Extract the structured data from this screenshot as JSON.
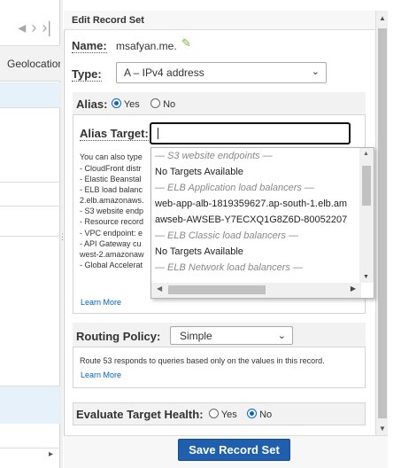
{
  "left_pane": {
    "column_header": "Geolocation"
  },
  "panel": {
    "title": "Edit Record Set",
    "name_label": "Name:",
    "name_value": "msafyan.me.",
    "type_label": "Type:",
    "type_value": "A – IPv4 address",
    "alias": {
      "label": "Alias:",
      "yes": "Yes",
      "no": "No",
      "selected": "Yes",
      "target_label": "Alias Target:",
      "target_value": "",
      "help_intro": "You can also type",
      "help_items": [
        "- CloudFront distr",
        "- Elastic Beanstal",
        "- ELB load balanc",
        "2.elb.amazonaws.",
        "- S3 website endp",
        "- Resource record",
        "- VPC endpoint: e",
        "- API Gateway cu",
        "west-2.amazonaw",
        "- Global Accelerat"
      ],
      "learn_more": "Learn More",
      "dropdown_items": [
        {
          "text": "— S3 website endpoints —",
          "group": true
        },
        {
          "text": "No Targets Available",
          "group": false
        },
        {
          "text": "— ELB Application load balancers —",
          "group": true
        },
        {
          "text": "web-app-alb-1819359627.ap-south-1.elb.am",
          "group": false
        },
        {
          "text": "awseb-AWSEB-Y7ECXQ1G8Z6D-80052207",
          "group": false
        },
        {
          "text": "— ELB Classic load balancers —",
          "group": true
        },
        {
          "text": "No Targets Available",
          "group": false
        },
        {
          "text": "— ELB Network load balancers —",
          "group": true
        }
      ]
    },
    "routing": {
      "label": "Routing Policy:",
      "value": "Simple",
      "description": "Route 53 responds to queries based only on the values in this record.",
      "learn_more": "Learn More"
    },
    "evaluate": {
      "label": "Evaluate Target Health:",
      "yes": "Yes",
      "no": "No",
      "selected": "No"
    },
    "save_button": "Save Record Set"
  },
  "colors": {
    "accent": "#0a64c8",
    "button": "#1f5fae",
    "link": "#0066c0",
    "selection": "#e6f1fa"
  }
}
